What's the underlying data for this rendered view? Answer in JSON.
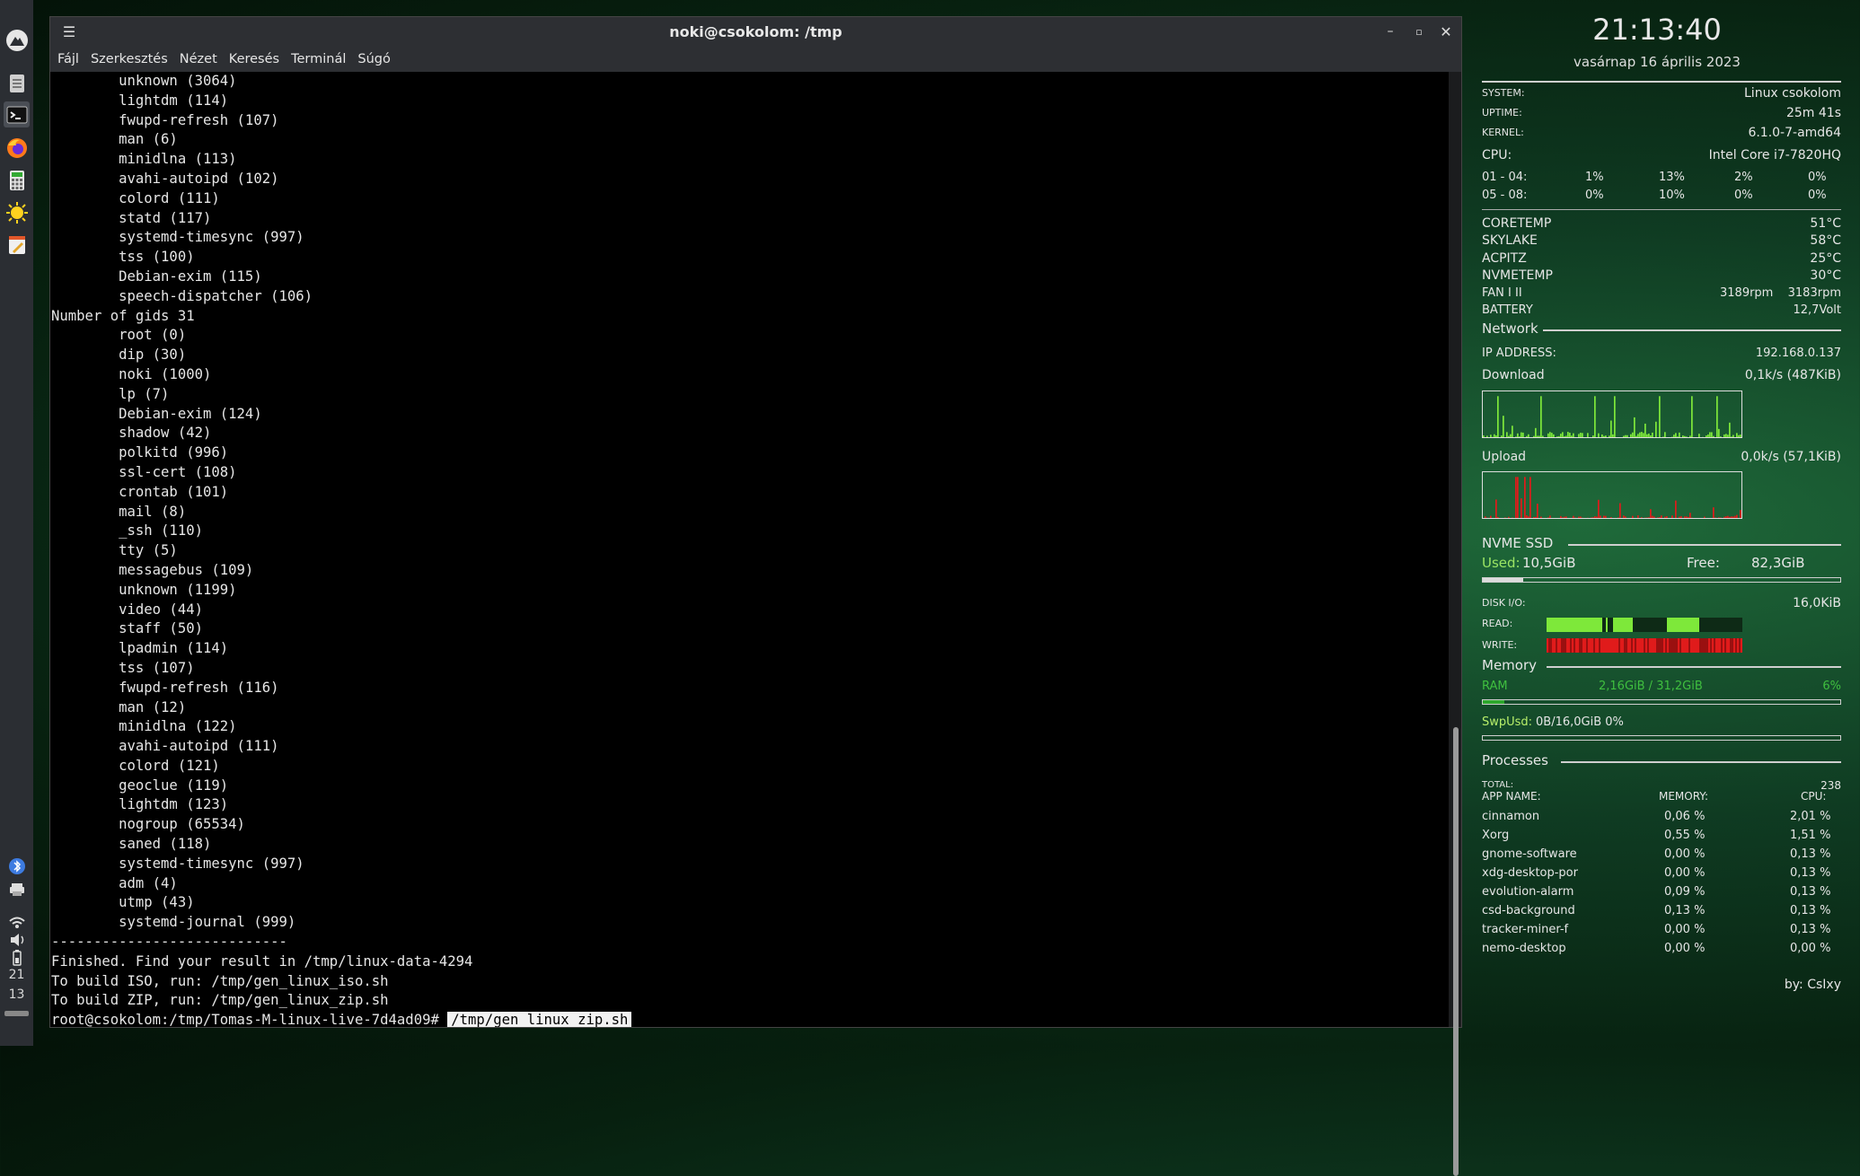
{
  "window": {
    "title": "noki@csokolom: /tmp",
    "menu": [
      "Fájl",
      "Szerkesztés",
      "Nézet",
      "Keresés",
      "Terminál",
      "Súgó"
    ]
  },
  "terminal": {
    "lines": [
      "        unknown (3064)",
      "        lightdm (114)",
      "        fwupd-refresh (107)",
      "        man (6)",
      "        minidlna (113)",
      "        avahi-autoipd (102)",
      "        colord (111)",
      "        statd (117)",
      "        systemd-timesync (997)",
      "        tss (100)",
      "        Debian-exim (115)",
      "        speech-dispatcher (106)",
      "Number of gids 31",
      "        root (0)",
      "        dip (30)",
      "        noki (1000)",
      "        lp (7)",
      "        Debian-exim (124)",
      "        shadow (42)",
      "        polkitd (996)",
      "        ssl-cert (108)",
      "        crontab (101)",
      "        mail (8)",
      "        _ssh (110)",
      "        tty (5)",
      "        messagebus (109)",
      "        unknown (1199)",
      "        video (44)",
      "        staff (50)",
      "        lpadmin (114)",
      "        tss (107)",
      "        fwupd-refresh (116)",
      "        man (12)",
      "        minidlna (122)",
      "        avahi-autoipd (111)",
      "        colord (121)",
      "        geoclue (119)",
      "        lightdm (123)",
      "        nogroup (65534)",
      "        saned (118)",
      "        systemd-timesync (997)",
      "        adm (4)",
      "        utmp (43)",
      "        systemd-journal (999)",
      "----------------------------",
      "Finished. Find your result in /tmp/linux-data-4294",
      "To build ISO, run: /tmp/gen_linux_iso.sh",
      "To build ZIP, run: /tmp/gen_linux_zip.sh"
    ],
    "prompt": "root@csokolom:/tmp/Tomas-M-linux-live-7d4ad09# ",
    "command": "/tmp/gen_linux_zip.sh"
  },
  "panel": {
    "icons": [
      "menu-icon",
      "files-icon",
      "terminal-icon",
      "firefox-icon",
      "calculator-icon",
      "weather-icon",
      "text-editor-icon"
    ],
    "clock_hour": "21",
    "clock_min": "13"
  },
  "conky": {
    "time": "21:13:40",
    "date": "vasárnap 16 április 2023",
    "system_label": "SYSTEM:",
    "system_value": "Linux csokolom",
    "uptime_label": "UPTIME:",
    "uptime_value": "25m 41s",
    "kernel_label": "KERNEL:",
    "kernel_value": "6.1.0-7-amd64",
    "cpu_label": "CPU:",
    "cpu_value": "Intel Core i7-7820HQ",
    "cpu_rows": [
      {
        "label": "01 - 04:",
        "values": [
          "1%",
          "13%",
          "2%",
          "0%"
        ]
      },
      {
        "label": "05 - 08:",
        "values": [
          "0%",
          "10%",
          "0%",
          "0%"
        ]
      }
    ],
    "sensors": [
      {
        "label": "CORETEMP",
        "value": "51°C"
      },
      {
        "label": "SKYLAKE",
        "value": "58°C"
      },
      {
        "label": "ACPITZ",
        "value": "25°C"
      },
      {
        "label": "NVMETEMP",
        "value": "30°C"
      }
    ],
    "fan_label": "FAN I II",
    "fan1": "3189rpm",
    "fan2": "3183rpm",
    "battery_label": "BATTERY",
    "battery_value": "12,7Volt",
    "network_title": "Network",
    "ip_label": "IP ADDRESS:",
    "ip_value": "192.168.0.137",
    "download_label": "Download",
    "download_value": "0,1k/s (487KiB)",
    "upload_label": "Upload",
    "upload_value": "0,0k/s (57,1KiB)",
    "disk_title": "NVME SSD",
    "used_label": "Used:",
    "used_value": "10,5GiB",
    "free_label": "Free:",
    "free_value": "82,3GiB",
    "disk_used_fraction": 0.113,
    "diskio_label": "DISK I/O:",
    "diskio_value": "16,0KiB",
    "read_label": "READ:",
    "write_label": "WRITE:",
    "memory_title": "Memory",
    "ram_label": "RAM",
    "ram_value": "2,16GiB / 31,2GiB",
    "ram_pct": "6%",
    "ram_fraction": 0.06,
    "swap_label": "SwpUsd:",
    "swap_value": "0B/16,0GiB 0%",
    "processes_title": "Processes",
    "total_label": "TOTAL:",
    "total_value": "238",
    "proc_headers": [
      "APP NAME:",
      "MEMORY:",
      "CPU:"
    ],
    "processes": [
      {
        "name": "cinnamon",
        "mem": "0,06 %",
        "cpu": "2,01 %"
      },
      {
        "name": "Xorg",
        "mem": "0,55 %",
        "cpu": "1,51 %"
      },
      {
        "name": "gnome-software",
        "mem": "0,00 %",
        "cpu": "0,13 %"
      },
      {
        "name": "xdg-desktop-por",
        "mem": "0,00 %",
        "cpu": "0,13 %"
      },
      {
        "name": "evolution-alarm",
        "mem": "0,09 %",
        "cpu": "0,13 %"
      },
      {
        "name": "csd-background",
        "mem": "0,13 %",
        "cpu": "0,13 %"
      },
      {
        "name": "tracker-miner-f",
        "mem": "0,00 %",
        "cpu": "0,13 %"
      },
      {
        "name": "nemo-desktop",
        "mem": "0,00 %",
        "cpu": "0,00 %"
      }
    ],
    "credit": "by: CsIxy",
    "colors": {
      "green": "#7ee83a",
      "red": "#e01b1b",
      "label_green": "#9be564"
    }
  }
}
